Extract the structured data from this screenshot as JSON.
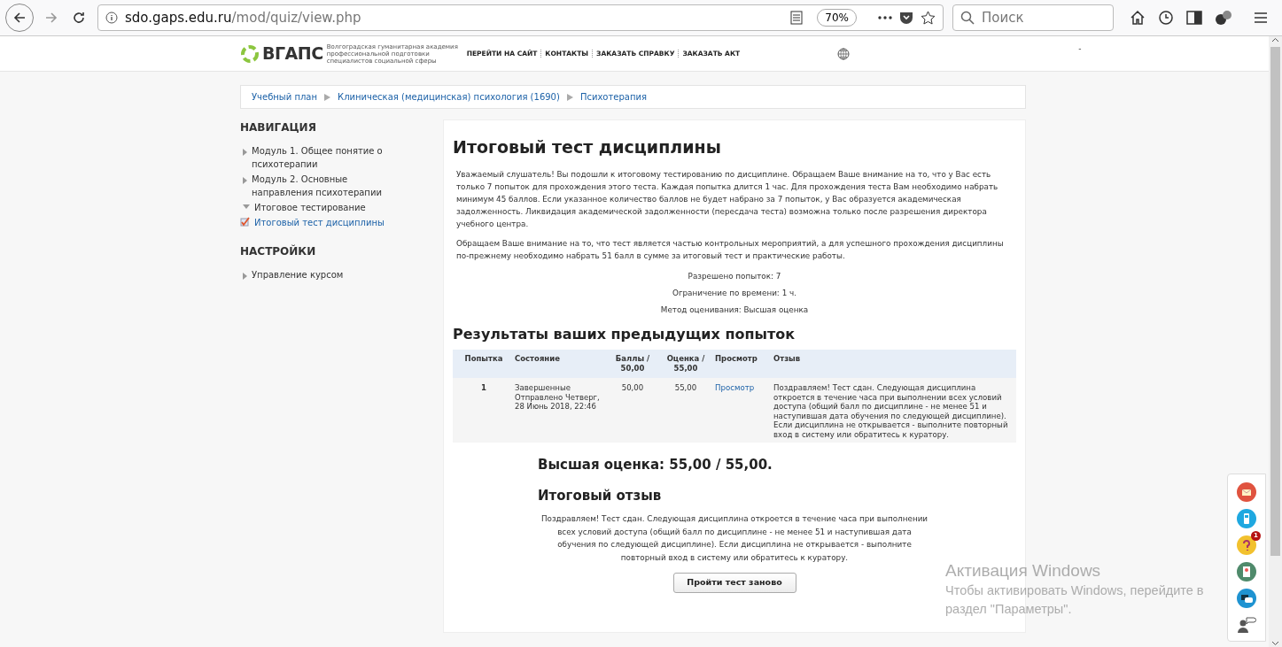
{
  "browser": {
    "url_host": "sdo.gaps.edu.ru",
    "url_path": "/mod/quiz/view.php",
    "zoom": "70%",
    "search_placeholder": "Поиск"
  },
  "header": {
    "logo": "ВГАПС",
    "logo_caption": "Волгоградская гуманитарная академия профессиональной подготовки специалистов социальной сферы",
    "links": [
      "ПЕРЕЙТИ НА САЙТ",
      "КОНТАКТЫ",
      "ЗАКАЗАТЬ СПРАВКУ",
      "ЗАКАЗАТЬ АКТ"
    ],
    "user_menu": "-"
  },
  "breadcrumbs": [
    "Учебный план",
    "Клиническая (медицинская) психология (1690)",
    "Психотерапия"
  ],
  "sidebar": [
    {
      "title": "НАВИГАЦИЯ",
      "items": [
        {
          "label": "Модуль 1. Общее понятие о психотерапии",
          "kind": "collapsed",
          "selected": false
        },
        {
          "label": "Модуль 2. Основные направления психотерапии",
          "kind": "collapsed",
          "selected": false
        },
        {
          "label": "Итоговое тестирование",
          "kind": "expanded",
          "selected": false
        },
        {
          "label": "Итоговый тест дисциплины",
          "kind": "quiz",
          "selected": true
        }
      ]
    },
    {
      "title": "НАСТРОЙКИ",
      "items": [
        {
          "label": "Управление курсом",
          "kind": "collapsed",
          "selected": false
        }
      ]
    }
  ],
  "main": {
    "title": "Итоговый тест дисциплины",
    "intro": [
      "Уважаемый слушатель! Вы подошли к итоговому тестированию по дисциплине. Обращаем Ваше внимание на то, что у Вас есть только 7 попыток для прохождения этого теста.  Каждая попытка длится 1 час. Для прохождения теста Вам необходимо набрать минимум 45 баллов. Если указанное количество баллов не будет набрано за 7 попыток, у Вас образуется академическая задолженность. Ликвидация академической задолженности (пересдача теста) возможна только после разрешения директора учебного центра.",
      "Обращаем Ваше внимание на то, что тест является частью контрольных мероприятий, а для успешного прохождения дисциплины по-прежнему необходимо набрать 51 балл в сумме за итоговый тест и практические работы."
    ],
    "info": [
      "Разрешено попыток: 7",
      "Ограничение по времени: 1 ч.",
      "Метод оценивания: Высшая оценка"
    ],
    "results_title": "Результаты ваших предыдущих попыток",
    "table": {
      "columns": [
        "Попытка",
        "Состояние",
        "Баллы / 50,00",
        "Оценка / 55,00",
        "Просмотр",
        "Отзыв"
      ],
      "rows": [
        {
          "attempt": "1",
          "state": "Завершенные",
          "state_detail": "Отправлено Четверг, 28 Июнь 2018, 22:46",
          "points": "50,00",
          "grade": "55,00",
          "review": "Просмотр",
          "feedback": "Поздравляем! Тест сдан. Следующая дисциплина откроется в течение часа при выполнении всех условий доступа (общий балл по дисциплине - не менее 51 и наступившая дата обучения по следующей дисциплине). Если дисциплина не открывается - выполните повторный вход в систему или обратитесь к куратору."
        }
      ]
    },
    "best_grade": "Высшая оценка: 55,00 / 55,00.",
    "feedback_title": "Итоговый отзыв",
    "feedback": "Поздравляем! Тест сдан. Следующая дисциплина откроется в течение часа при выполнении всех условий доступа (общий балл по дисциплине - не менее 51 и наступившая дата обучения по следующей дисциплине). Если дисциплина не открывается - выполните повторный вход в систему или обратитесь к куратору.",
    "retry_button": "Пройти тест заново"
  },
  "side_widgets": [
    {
      "kind": "mail",
      "color": "#e0533f"
    },
    {
      "kind": "phone",
      "color": "#1fa8e0"
    },
    {
      "kind": "help",
      "color": "#f2c12e",
      "badge": "1"
    },
    {
      "kind": "report",
      "color": "#4f8a6b"
    },
    {
      "kind": "chat",
      "color": "#1f93d1"
    },
    {
      "kind": "consultant",
      "color": "#555555"
    }
  ],
  "os_notice": {
    "title": "Активация Windows",
    "text": "Чтобы активировать Windows, перейдите в раздел \"Параметры\"."
  }
}
